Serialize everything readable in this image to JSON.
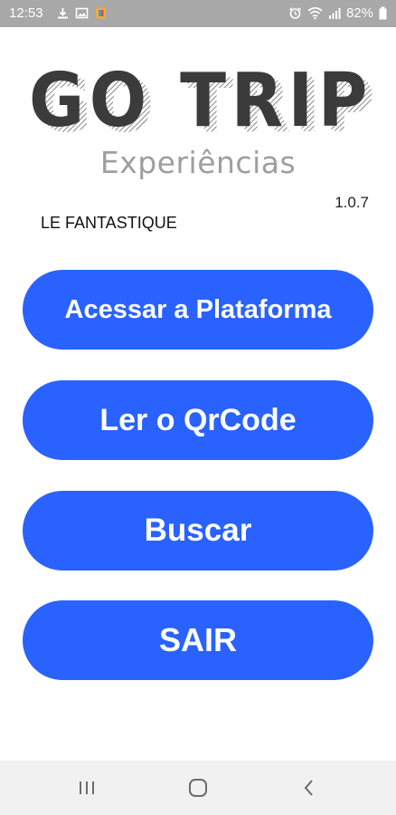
{
  "status_bar": {
    "time": "12:53",
    "battery": "82%",
    "icons": [
      "download-icon",
      "image-icon",
      "app-notification-icon",
      "alarm-icon",
      "wifi-icon",
      "signal-icon",
      "battery-icon"
    ]
  },
  "logo": {
    "title": "GO TRIP",
    "subtitle": "Experiências"
  },
  "version": "1.0.7",
  "company": "LE FANTASTIQUE",
  "buttons": {
    "access": "Acessar a Plataforma",
    "qrcode": "Ler o QrCode",
    "search": "Buscar",
    "exit": "SAIR"
  },
  "colors": {
    "button": "#2962ff",
    "status_bar": "#a8a8a8",
    "logo_dark": "#3b3b3b",
    "subtitle": "#9e9e9e"
  },
  "nav_bar": {
    "icons": [
      "recents-icon",
      "home-icon",
      "back-icon"
    ]
  }
}
